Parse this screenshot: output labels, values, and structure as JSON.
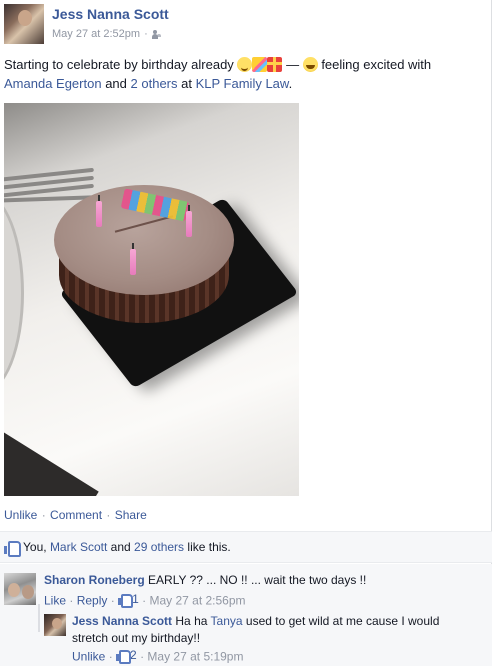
{
  "post": {
    "author": "Jess Nanna Scott",
    "timestamp": "May 27 at 2:52pm",
    "audience_icon": "friends-icon",
    "status": {
      "text_before": "Starting to celebrate by birthday already",
      "dash": "—",
      "feeling": "feeling excited with",
      "tagged_1": "Amanda Egerton",
      "and": "and",
      "tagged_others": "2 others",
      "at": "at",
      "place": "KLP Family Law",
      "period": "."
    },
    "photo_alt_icon": "birthday-cake-photo"
  },
  "actions": {
    "unlike": "Unlike",
    "comment": "Comment",
    "share": "Share",
    "separator": "·"
  },
  "likes": {
    "you": "You,",
    "person": "Mark Scott",
    "and": "and",
    "others": "29 others",
    "suffix": "like this."
  },
  "comments": [
    {
      "name": "Sharon Roneberg",
      "text": "EARLY ?? ... NO !! ... wait the two days !!",
      "like_label": "Like",
      "reply_label": "Reply",
      "like_count": "1",
      "timestamp": "May 27 at 2:56pm"
    },
    {
      "name": "Jess Nanna Scott",
      "text_before": "Ha ha",
      "mention": "Tanya",
      "text_after": "used to get wild at me cause I would stretch out my birthday!!",
      "like_label": "Unlike",
      "like_count": "2",
      "timestamp": "May 27 at 5:19pm"
    }
  ],
  "colors": {
    "link": "#3b5998",
    "meta": "#9197a3",
    "panel": "#f6f7f9"
  }
}
